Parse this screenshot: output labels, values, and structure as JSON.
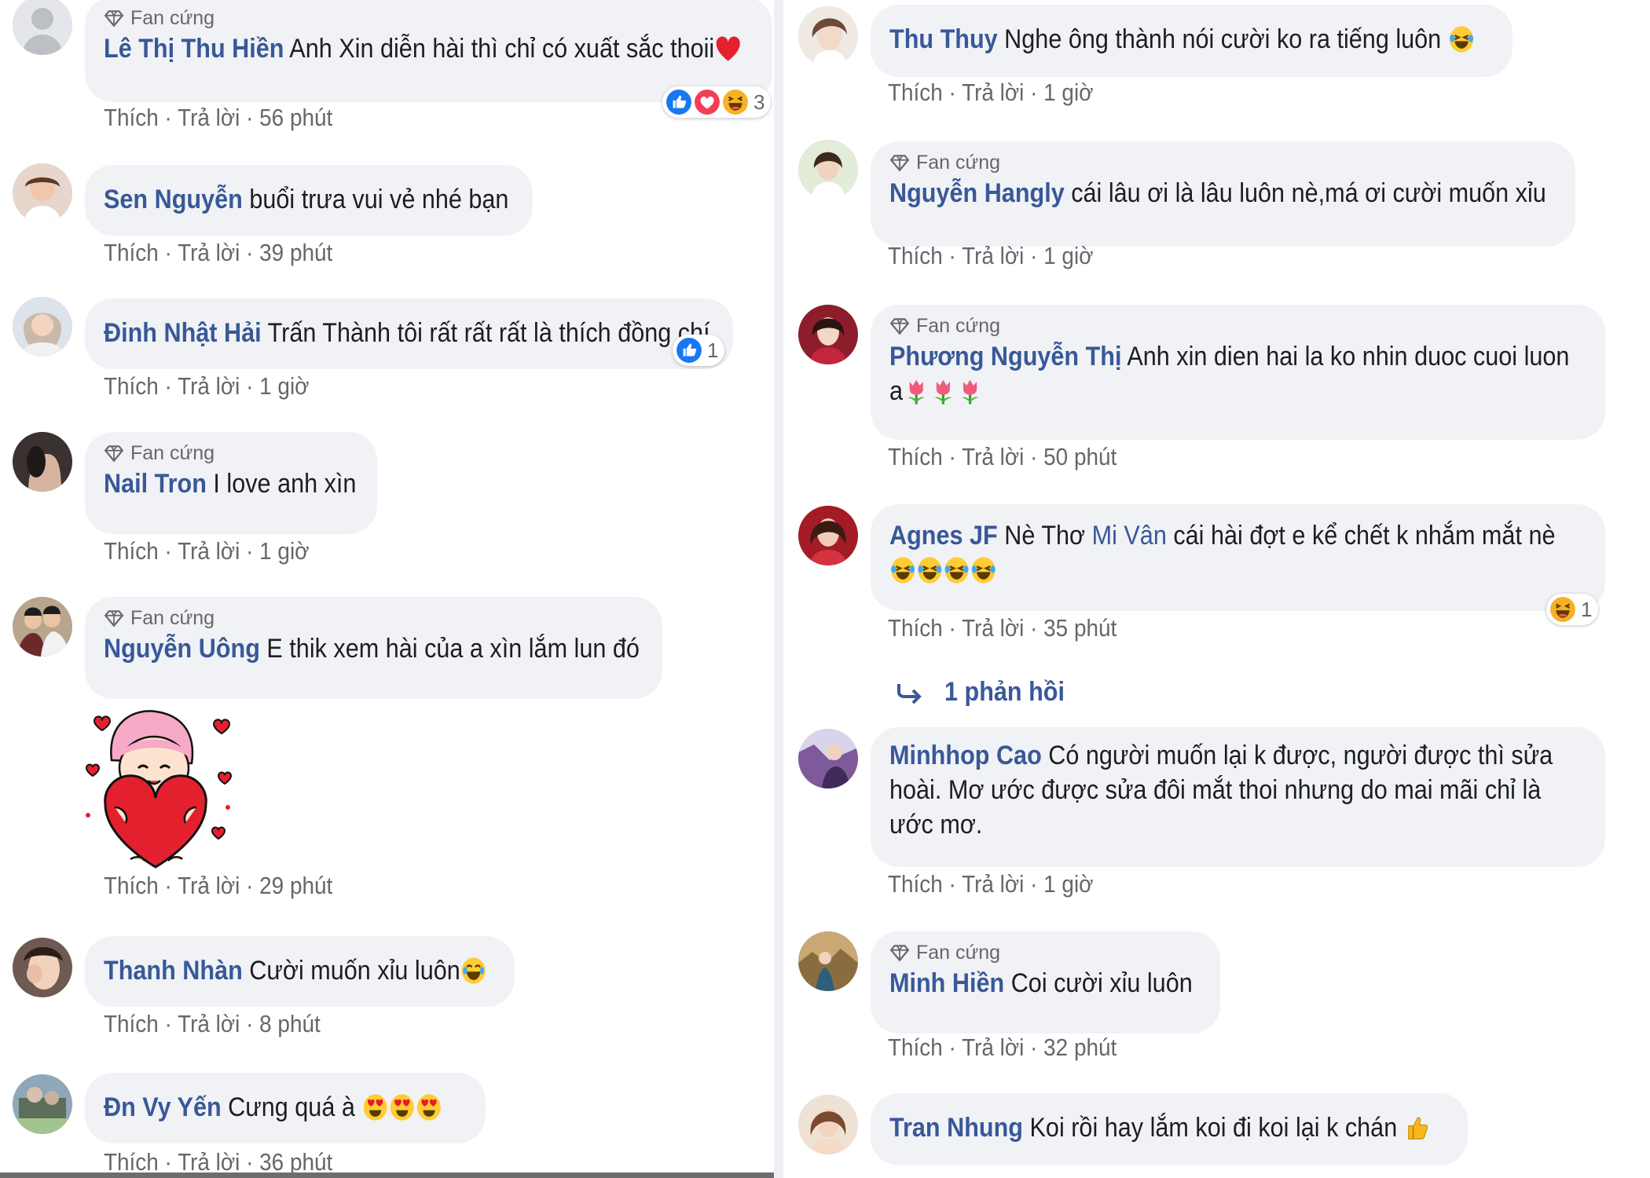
{
  "fan_badge": "Fan cứng",
  "actions": {
    "like": "Thích",
    "reply": "Trả lời",
    "sep": " · "
  },
  "colors": {
    "author": "#385898",
    "bubble": "#f0f2f5",
    "meta": "#65676b",
    "like_blue": "#1877f2"
  },
  "left_comments": [
    {
      "author": "Lê Thị Thu Hiền",
      "text": "Anh Xin diễn hài thì chỉ có xuất sắc thoii",
      "emoji": "heart-icon",
      "badge": true,
      "time": "56 phút",
      "reactions": {
        "icons": [
          "like-icon",
          "love-icon",
          "haha-icon"
        ],
        "count": "3"
      }
    },
    {
      "author": "Sen Nguyễn",
      "text": "buổi trưa vui vẻ nhé bạn",
      "badge": false,
      "time": "39 phút"
    },
    {
      "author": "Đinh Nhật Hải",
      "text": "Trấn Thành tôi rất rất rất là thích đồng chí",
      "badge": false,
      "time": "1 giờ",
      "reactions": {
        "icons": [
          "like-icon"
        ],
        "count": "1"
      }
    },
    {
      "author": "Nail Tron",
      "text": "I love anh xìn",
      "badge": true,
      "time": "1 giờ"
    },
    {
      "author": "Nguyễn Uông",
      "text": "E thik xem hài của a xìn lắm lun đó",
      "badge": true,
      "time": "29 phút",
      "sticker": "heart-hug-sticker"
    },
    {
      "author": "Thanh Nhàn",
      "text": "Cười muốn xỉu luôn",
      "emoji": "laughing-tears-icon",
      "badge": false,
      "time": "8 phút"
    },
    {
      "author": "Đn Vy Yến",
      "text": "Cưng quá à",
      "emojis_after": [
        "heart-eyes-icon",
        "heart-eyes-icon",
        "heart-eyes-icon"
      ],
      "badge": false,
      "time": "36 phút"
    }
  ],
  "right_comments": [
    {
      "author": "Thu Thuy",
      "text": "Nghe ông thành nói cười ko ra tiếng luôn",
      "emoji": "rofl-icon",
      "badge": false,
      "time": "1 giờ"
    },
    {
      "author": "Nguyễn Hangly",
      "text": "cái lâu ơi là lâu luôn nè,má ơi cười muốn xỉu",
      "badge": true,
      "time": "1 giờ"
    },
    {
      "author": "Phương Nguyễn Thị",
      "text_line1": "Anh xin dien hai la ko nhin duoc cuoi luon",
      "text_line2": "a",
      "emojis_after": [
        "tulip-icon",
        "tulip-icon",
        "tulip-icon"
      ],
      "badge": true,
      "time": "50 phút"
    },
    {
      "author": "Agnes JF",
      "text_pre": "Nè Thơ",
      "mention": "Mi Vân",
      "text": "cái hài đợt e kể chết k nhắm mắt nè",
      "emojis_after": [
        "rofl-icon",
        "rofl-icon",
        "rofl-icon",
        "rofl-icon"
      ],
      "badge": false,
      "time": "35 phút",
      "reactions": {
        "icons": [
          "haha-icon"
        ],
        "count": "1"
      },
      "replies": "1 phản hồi"
    },
    {
      "author": "Minhhop Cao",
      "text_line1": "Có người muốn lại k được, người được thì sửa",
      "text_line2": "hoài. Mơ ước được sửa đôi mắt thoi nhưng do mai mãi chỉ là",
      "text_line3": "ước mơ.",
      "badge": false,
      "time": "1 giờ"
    },
    {
      "author": "Minh Hiền",
      "text": "Coi cười xỉu luôn",
      "badge": true,
      "time": "32 phút"
    },
    {
      "author": "Tran Nhung",
      "text": "Koi rồi hay lắm koi đi koi lại k chán",
      "emoji": "thumbs-up-emoji",
      "badge": false,
      "time": ""
    }
  ]
}
